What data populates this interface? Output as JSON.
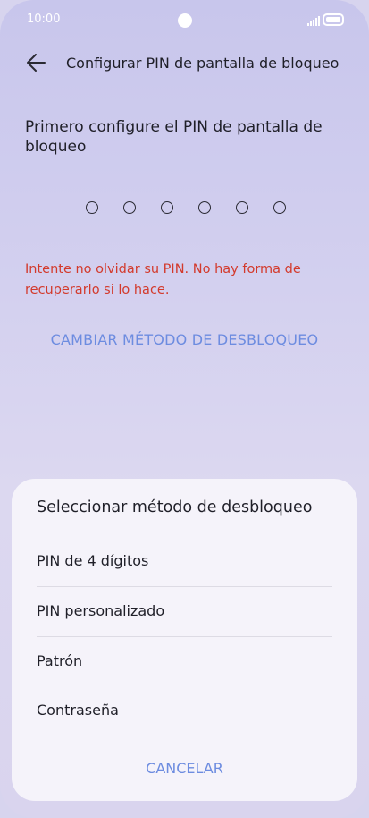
{
  "status_bar": {
    "time": "10:00",
    "signal_icon": "signal-icon",
    "battery_icon": "battery-icon"
  },
  "header": {
    "back_icon": "arrow-left-icon",
    "title": "Configurar PIN de pantalla de bloqueo"
  },
  "main": {
    "prompt": "Primero configure el PIN de pantalla de bloqueo",
    "warning": "Intente no olvidar su PIN. No hay forma de recuperarlo si lo hace.",
    "change_method": "CAMBIAR MÉTODO DE DESBLOQUEO"
  },
  "sheet": {
    "title": "Seleccionar método de desbloqueo",
    "options": [
      {
        "label": "PIN de 4 dígitos"
      },
      {
        "label": "PIN personalizado"
      },
      {
        "label": "Patrón"
      },
      {
        "label": "Contraseña"
      }
    ],
    "cancel": "CANCELAR"
  },
  "colors": {
    "accent": "#6d8ce0",
    "warning": "#d33a2c",
    "sheet_bg": "#f5f3fa"
  }
}
